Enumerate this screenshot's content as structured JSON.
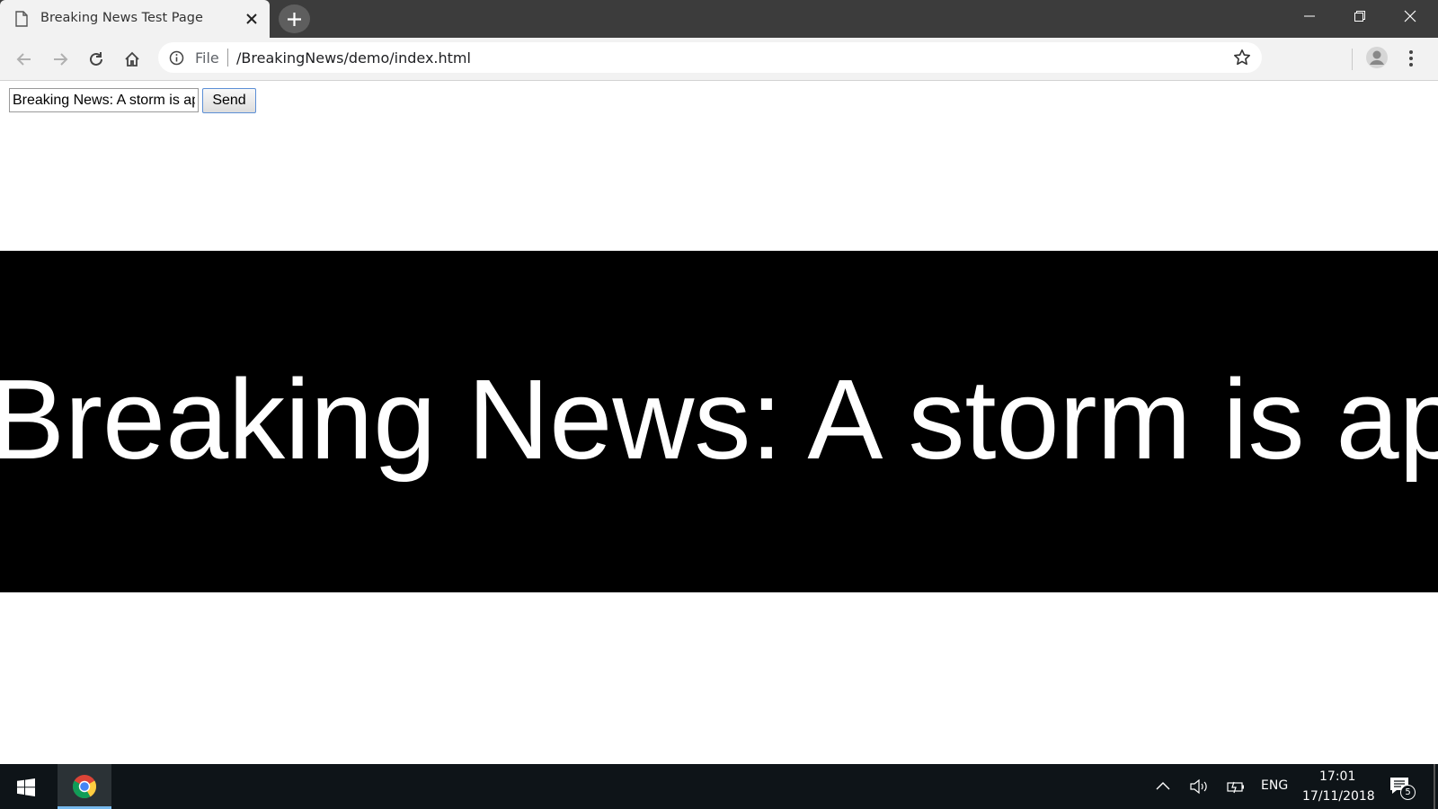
{
  "browser": {
    "tab": {
      "title": "Breaking News Test Page"
    },
    "address": {
      "scheme_label": "File",
      "url": "/BreakingNews/demo/index.html"
    }
  },
  "page": {
    "news_input": {
      "value": "Breaking News: A storm is approaching"
    },
    "send_button": {
      "label": "Send"
    },
    "banner": {
      "text": "Breaking News: A storm is approaching"
    }
  },
  "taskbar": {
    "language": "ENG",
    "time": "17:01",
    "date": "17/11/2018",
    "notification_count": "5"
  },
  "colors": {
    "banner_bg": "#000000",
    "banner_text": "#ffffff",
    "taskbar_bg": "#0e1418",
    "titlebar_bg": "#3c3c3c"
  }
}
